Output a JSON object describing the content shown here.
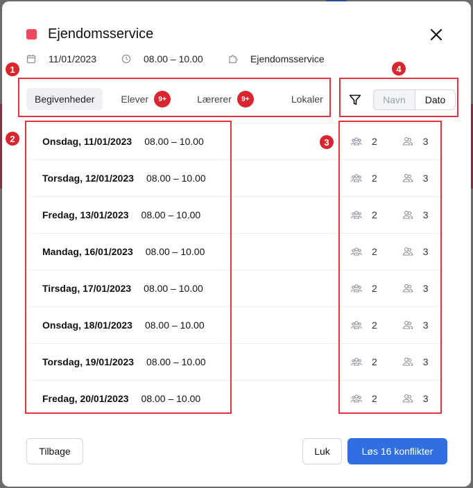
{
  "theme": {
    "swatch": "#f0485f",
    "primary": "#2f6fe0",
    "badge": "#d9262e",
    "highlight": "#e0323f"
  },
  "dialog": {
    "title": "Ejendomsservice",
    "meta": {
      "date": "11/01/2023",
      "time": "08.00 – 10.00",
      "resource": "Ejendomsservice"
    }
  },
  "markers": [
    "1",
    "2",
    "3",
    "4"
  ],
  "tabs": [
    {
      "label": "Begivenheder",
      "active": true
    },
    {
      "label": "Elever",
      "badge": "9+"
    },
    {
      "label": "Lærerer",
      "badge": "9+"
    },
    {
      "label": "Lokaler"
    }
  ],
  "sort": {
    "options": [
      "Navn",
      "Dato"
    ],
    "selected": "Dato"
  },
  "events": [
    {
      "day": "Onsdag, 11/01/2023",
      "time": "08.00 – 10.00",
      "groups": "2",
      "people": "3"
    },
    {
      "day": "Torsdag, 12/01/2023",
      "time": "08.00 – 10.00",
      "groups": "2",
      "people": "3"
    },
    {
      "day": "Fredag, 13/01/2023",
      "time": "08.00 – 10.00",
      "groups": "2",
      "people": "3"
    },
    {
      "day": "Mandag, 16/01/2023",
      "time": "08.00 – 10.00",
      "groups": "2",
      "people": "3"
    },
    {
      "day": "Tirsdag, 17/01/2023",
      "time": "08.00 – 10.00",
      "groups": "2",
      "people": "3"
    },
    {
      "day": "Onsdag, 18/01/2023",
      "time": "08.00 – 10.00",
      "groups": "2",
      "people": "3"
    },
    {
      "day": "Torsdag, 19/01/2023",
      "time": "08.00 – 10.00",
      "groups": "2",
      "people": "3"
    },
    {
      "day": "Fredag, 20/01/2023",
      "time": "08.00 – 10.00",
      "groups": "2",
      "people": "3"
    }
  ],
  "footer": {
    "back": "Tilbage",
    "close": "Luk",
    "resolve": "Løs 16 konflikter"
  }
}
